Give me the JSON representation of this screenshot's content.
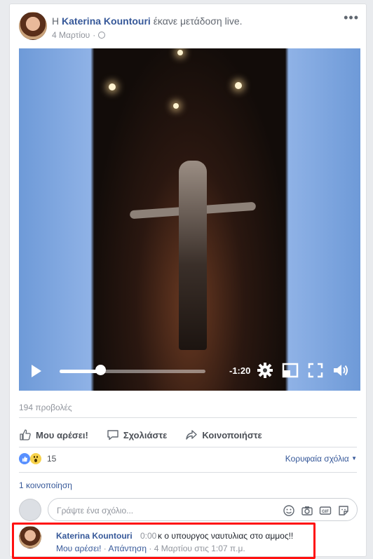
{
  "post": {
    "prefix": "Η",
    "author": "Katerina Kountouri",
    "action_text": "έκανε μετάδοση live.",
    "date": "4 Μαρτίου",
    "privacy_icon": "globe-icon",
    "more_icon": "more-options-icon"
  },
  "video": {
    "remaining_time": "-1:20",
    "progress": 0.28,
    "icons": [
      "play-icon",
      "settings-icon",
      "picture-in-picture-icon",
      "fullscreen-icon",
      "volume-icon"
    ]
  },
  "stats": {
    "views": "194 προβολές",
    "reaction_count": "15",
    "reaction_icons": [
      "like-reaction-icon",
      "wow-reaction-icon"
    ],
    "top_comments": "Κορυφαία σχόλια",
    "shares": "1 κοινοποίηση"
  },
  "actions": {
    "like": "Μου αρέσει!",
    "comment": "Σχολιάστε",
    "share": "Κοινοποιήστε"
  },
  "comment_box": {
    "placeholder": "Γράψτε ένα σχόλιο...",
    "icons": [
      "emoji-icon",
      "camera-icon",
      "gif-icon",
      "sticker-icon"
    ]
  },
  "comment": {
    "author": "Katerina Kountouri",
    "video_time": "0:00",
    "text": "κ ο υπουργος ναυτυλιας στο αμμος!!",
    "like": "Μου αρέσει!",
    "separator": "·",
    "reply": "Απάντηση",
    "timestamp": "4 Μαρτίου στις 1:07 π.μ."
  },
  "colors": {
    "link": "#365899",
    "highlight": "#ff1010",
    "like_blue": "#5890ff"
  }
}
